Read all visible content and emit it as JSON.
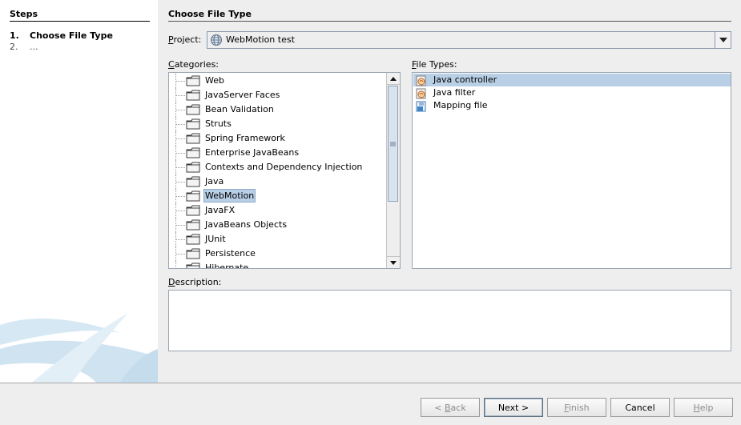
{
  "steps": {
    "title": "Steps",
    "items": [
      {
        "number": "1.",
        "label": "Choose File Type"
      },
      {
        "number": "2.",
        "label": "..."
      }
    ]
  },
  "panel": {
    "title": "Choose File Type",
    "project_label": "Project:",
    "project_value": "WebMotion test",
    "project_icon": "globe-project-icon",
    "categories_label": "Categories:",
    "file_types_label": "File Types:",
    "description_label": "Description:",
    "description_text": ""
  },
  "categories": [
    {
      "label": "Web"
    },
    {
      "label": "JavaServer Faces"
    },
    {
      "label": "Bean Validation"
    },
    {
      "label": "Struts"
    },
    {
      "label": "Spring Framework"
    },
    {
      "label": "Enterprise JavaBeans"
    },
    {
      "label": "Contexts and Dependency Injection"
    },
    {
      "label": "Java"
    },
    {
      "label": "WebMotion"
    },
    {
      "label": "JavaFX"
    },
    {
      "label": "JavaBeans Objects"
    },
    {
      "label": "JUnit"
    },
    {
      "label": "Persistence"
    },
    {
      "label": "Hibernate"
    }
  ],
  "selected_category": "WebMotion",
  "file_types": [
    {
      "label": "Java controller",
      "icon": "java-class-icon"
    },
    {
      "label": "Java filter",
      "icon": "java-class-icon"
    },
    {
      "label": "Mapping file",
      "icon": "mapping-file-icon"
    }
  ],
  "selected_file_type": "Java controller",
  "buttons": {
    "back": "< Back",
    "next": "Next >",
    "finish": "Finish",
    "cancel": "Cancel",
    "help": "Help"
  },
  "colors": {
    "selection": "#b8cfe5",
    "background": "#eeeeee",
    "border": "#9aa5b1"
  }
}
